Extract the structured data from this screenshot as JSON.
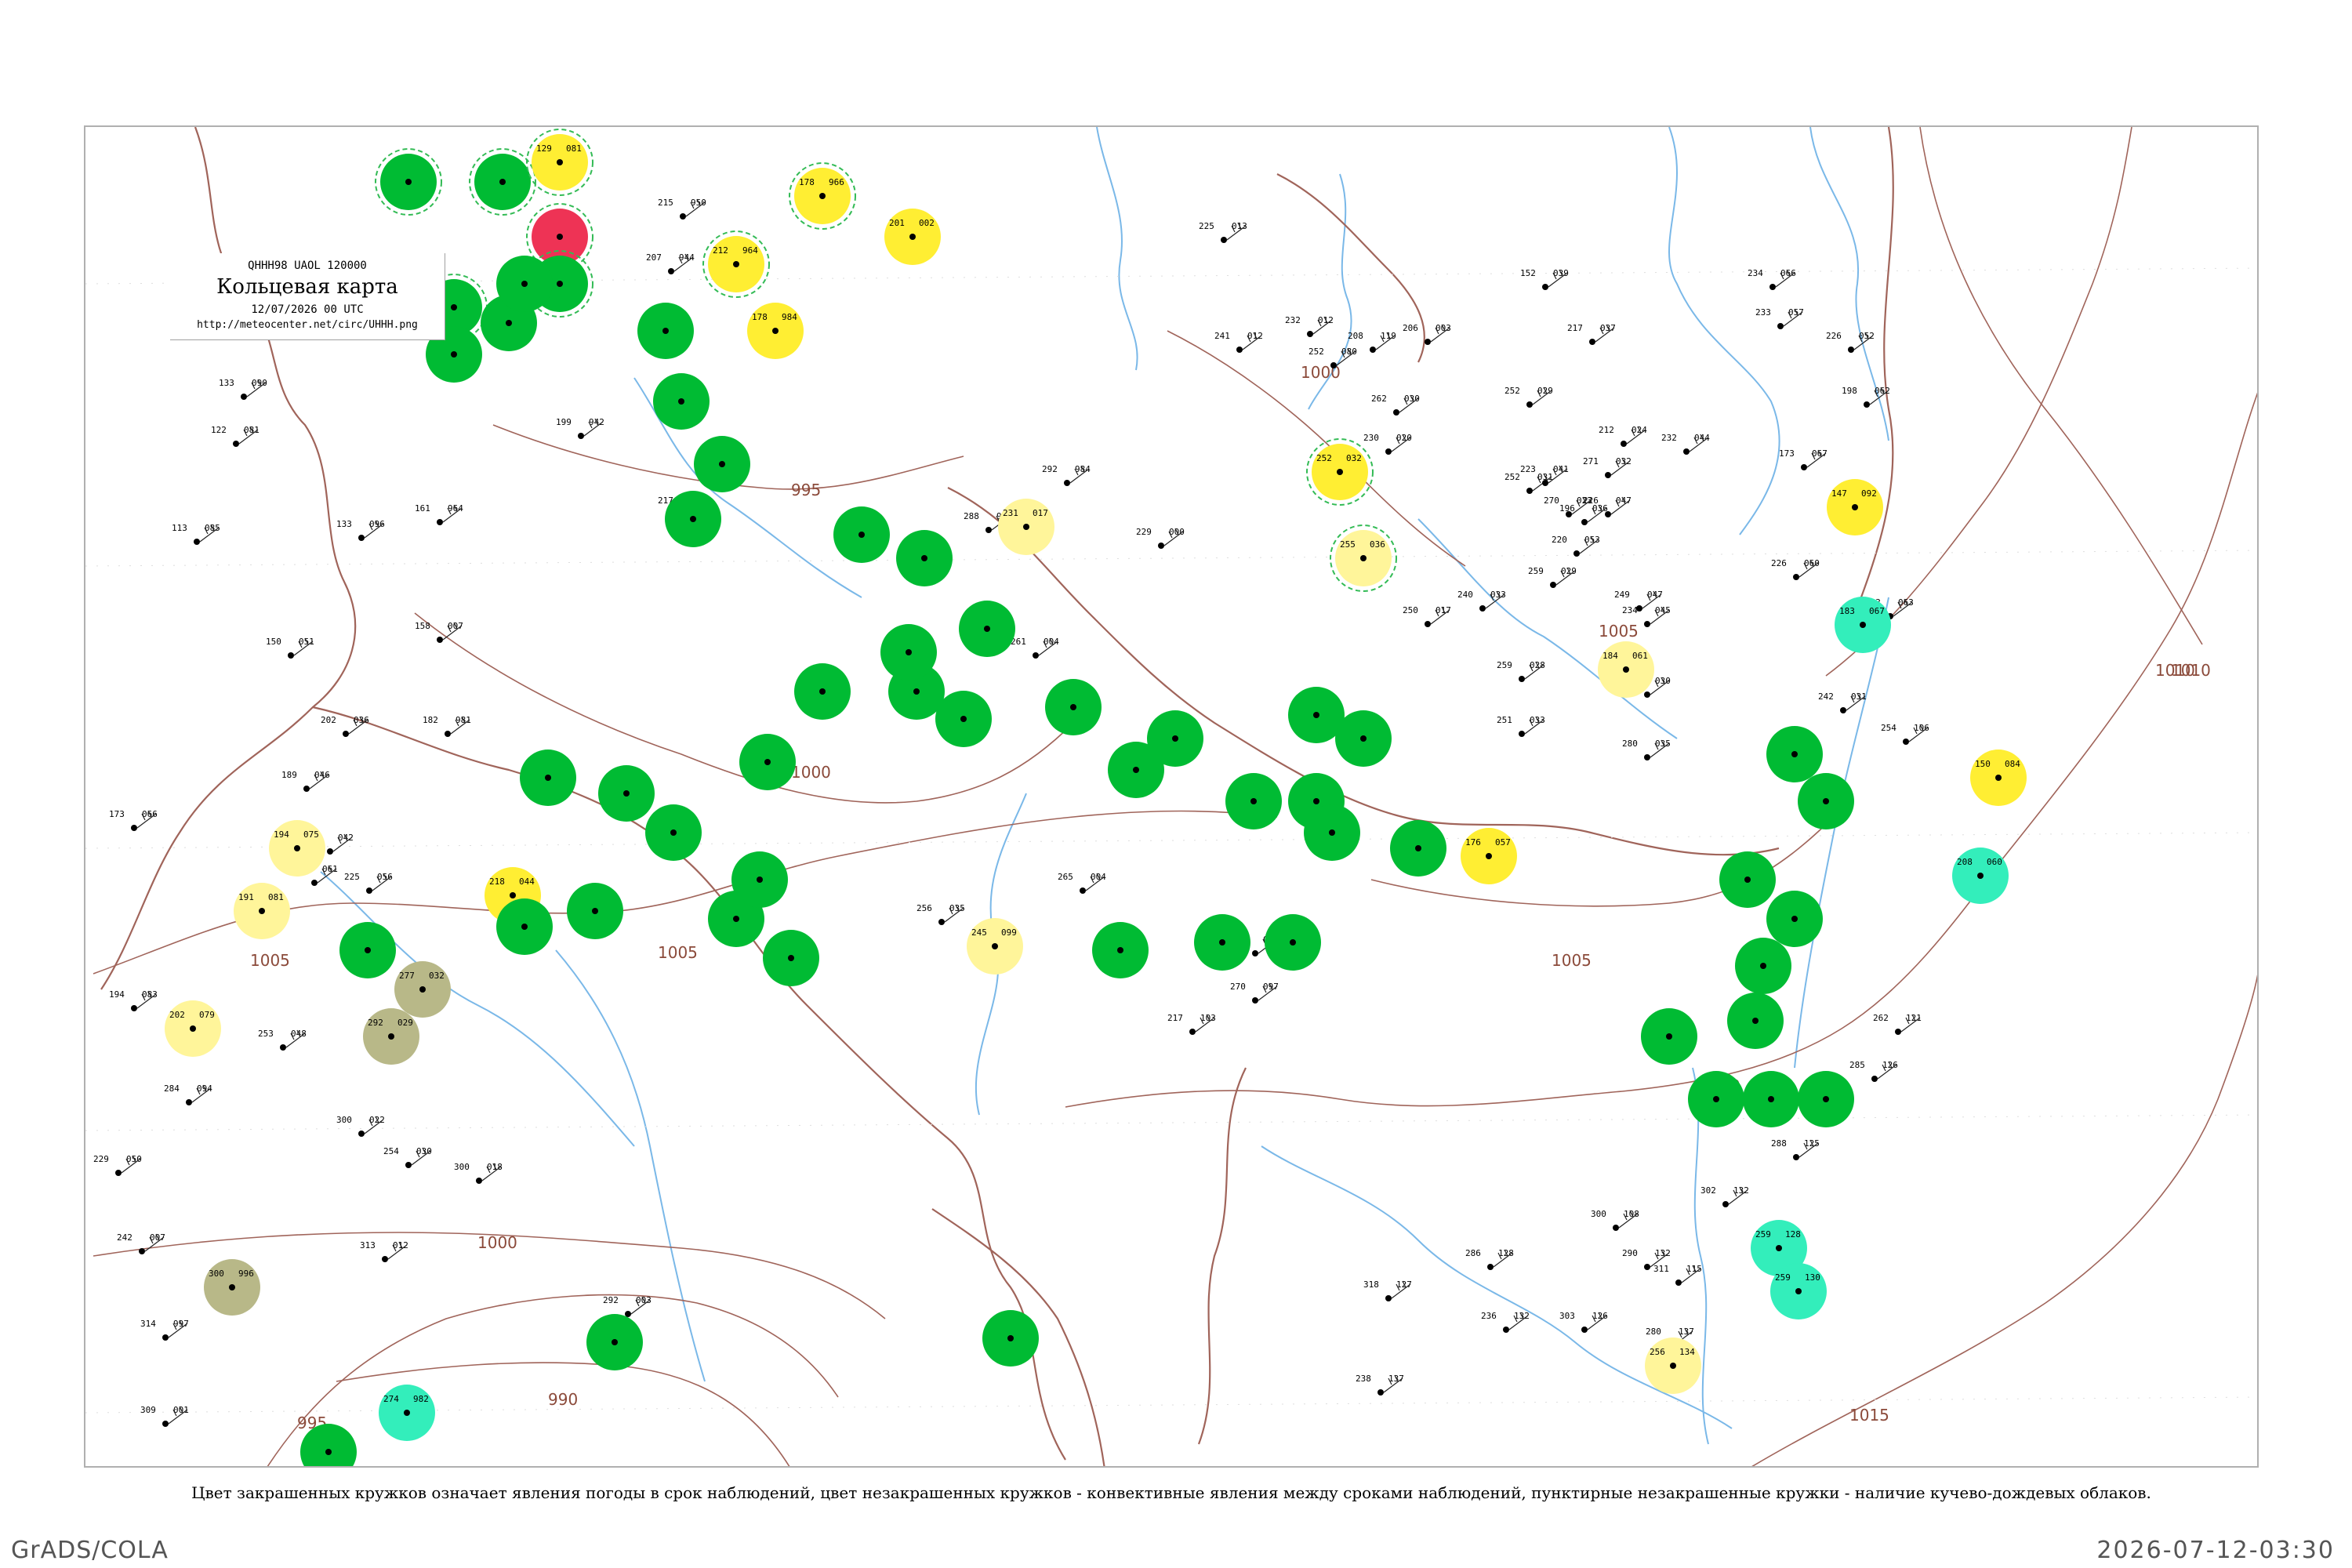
{
  "header": {
    "code_line": "QHHH98  UAOL  120000",
    "title": "Кольцевая карта",
    "date_line": "12/07/2026 00 UTC",
    "url": "http://meteocenter.net/circ/UHHH.png"
  },
  "caption": "Цвет закрашенных кружков означает явления погоды в срок наблюдений, цвет незакрашенных кружков - конвективные явления между сроками наблюдений, пунктирные незакрашенные кружки - наличие кучево-дождевых облаков.",
  "footer": {
    "left": "GrADS/COLA",
    "right": "2026-07-12-03:30"
  },
  "colors": {
    "green": "#00bb33",
    "yellow": "#ffee33",
    "pale_yellow": "#fff59a",
    "red": "#ee3355",
    "cyan": "#33eebb",
    "olive": "#b8b888",
    "isobar": "#a0645a",
    "river": "#7ab8e8",
    "dash_ring": "#33bb55"
  },
  "isobar_labels": [
    "1000",
    "995",
    "1000",
    "1005",
    "1005",
    "1005",
    "1010",
    "1005",
    "1005",
    "1010",
    "1000",
    "990",
    "995",
    "1015",
    "1010"
  ],
  "stations": [
    {
      "name": "s01",
      "fill": "green",
      "ring": true,
      "tl": "",
      "tr": "",
      "id": ""
    },
    {
      "name": "s02",
      "fill": "green",
      "ring": true,
      "tl": "",
      "tr": "",
      "id": ""
    },
    {
      "name": "s03",
      "fill": "yellow",
      "ring": true,
      "tl": "129",
      "tr": "081",
      "id": ""
    },
    {
      "name": "s04",
      "fill": "red",
      "ring": true,
      "tl": "",
      "tr": "",
      "id": ""
    },
    {
      "name": "s05",
      "fill": "green",
      "ring": true,
      "tl": "",
      "tr": "",
      "id": ""
    },
    {
      "name": "s06",
      "fill": "yellow",
      "ring": true,
      "tl": "178",
      "tr": "966",
      "id": ""
    },
    {
      "name": "s07",
      "fill": "yellow",
      "ring": false,
      "tl": "201",
      "tr": "002",
      "id": ""
    },
    {
      "name": "s08",
      "fill": "yellow",
      "ring": true,
      "tl": "212",
      "tr": "964",
      "id": ""
    },
    {
      "name": "s09",
      "fill": "yellow",
      "ring": false,
      "tl": "178",
      "tr": "984",
      "id": ""
    },
    {
      "name": "s10",
      "fill": "green",
      "ring": true,
      "tl": "",
      "tr": "",
      "id": ""
    },
    {
      "name": "s11",
      "fill": "green",
      "ring": false,
      "tl": "",
      "tr": "",
      "id": ""
    },
    {
      "name": "s12",
      "fill": "green",
      "ring": false,
      "tl": "",
      "tr": "",
      "id": ""
    },
    {
      "name": "s13",
      "fill": "green",
      "ring": false,
      "tl": "",
      "tr": "",
      "id": ""
    },
    {
      "name": "s14",
      "fill": "green",
      "ring": false,
      "tl": "",
      "tr": "",
      "id": ""
    },
    {
      "name": "s15",
      "fill": "green",
      "ring": false,
      "tl": "",
      "tr": "",
      "id": ""
    },
    {
      "name": "s16",
      "fill": "green",
      "ring": false,
      "tl": "",
      "tr": "",
      "id": ""
    },
    {
      "name": "s17",
      "fill": "green",
      "ring": false,
      "tl": "",
      "tr": "",
      "id": ""
    },
    {
      "name": "s18",
      "fill": "green",
      "ring": false,
      "tl": "",
      "tr": "",
      "id": ""
    },
    {
      "name": "s19",
      "fill": "green",
      "ring": false,
      "tl": "",
      "tr": "",
      "id": ""
    },
    {
      "name": "s20",
      "fill": "green",
      "ring": false,
      "tl": "",
      "tr": "",
      "id": ""
    },
    {
      "name": "s21",
      "fill": "green",
      "ring": false,
      "tl": "",
      "tr": "",
      "id": ""
    },
    {
      "name": "s22",
      "fill": "green",
      "ring": false,
      "tl": "",
      "tr": "",
      "id": ""
    },
    {
      "name": "s23",
      "fill": "yellow",
      "ring": false,
      "tl": "218",
      "tr": "044",
      "id": ""
    },
    {
      "name": "s24",
      "fill": "pale_yellow",
      "ring": false,
      "tl": "194",
      "tr": "075",
      "id": ""
    },
    {
      "name": "s25",
      "fill": "pale_yellow",
      "ring": false,
      "tl": "191",
      "tr": "081",
      "id": ""
    },
    {
      "name": "s26",
      "fill": "pale_yellow",
      "ring": false,
      "tl": "202",
      "tr": "079",
      "id": ""
    },
    {
      "name": "s27",
      "fill": "olive",
      "ring": false,
      "tl": "277",
      "tr": "032",
      "id": ""
    },
    {
      "name": "s28",
      "fill": "olive",
      "ring": false,
      "tl": "292",
      "tr": "029",
      "id": ""
    },
    {
      "name": "s29",
      "fill": "olive",
      "ring": false,
      "tl": "300",
      "tr": "996",
      "id": ""
    },
    {
      "name": "s30",
      "fill": "cyan",
      "ring": false,
      "tl": "274",
      "tr": "982",
      "id": ""
    },
    {
      "name": "s31",
      "fill": "green",
      "ring": false,
      "tl": "",
      "tr": "",
      "id": ""
    },
    {
      "name": "s32",
      "fill": "green",
      "ring": false,
      "tl": "",
      "tr": "",
      "id": ""
    },
    {
      "name": "s33",
      "fill": "pale_yellow",
      "ring": false,
      "tl": "231",
      "tr": "017",
      "id": ""
    },
    {
      "name": "s34",
      "fill": "pale_yellow",
      "ring": false,
      "tl": "245",
      "tr": "099",
      "id": ""
    },
    {
      "name": "s35",
      "fill": "yellow",
      "ring": true,
      "tl": "252",
      "tr": "032",
      "id": ""
    },
    {
      "name": "s36",
      "fill": "pale_yellow",
      "ring": true,
      "tl": "255",
      "tr": "036",
      "id": ""
    },
    {
      "name": "s37",
      "fill": "yellow",
      "ring": false,
      "tl": "176",
      "tr": "057",
      "id": ""
    },
    {
      "name": "s38",
      "fill": "pale_yellow",
      "ring": false,
      "tl": "184",
      "tr": "061",
      "id": ""
    },
    {
      "name": "s39",
      "fill": "yellow",
      "ring": false,
      "tl": "147",
      "tr": "092",
      "id": ""
    },
    {
      "name": "s40",
      "fill": "cyan",
      "ring": false,
      "tl": "183",
      "tr": "067",
      "id": ""
    },
    {
      "name": "s41",
      "fill": "yellow",
      "ring": false,
      "tl": "150",
      "tr": "084",
      "id": ""
    },
    {
      "name": "s42",
      "fill": "cyan",
      "ring": false,
      "tl": "208",
      "tr": "060",
      "id": ""
    },
    {
      "name": "s43",
      "fill": "cyan",
      "ring": false,
      "tl": "259",
      "tr": "128",
      "id": ""
    },
    {
      "name": "s44",
      "fill": "cyan",
      "ring": false,
      "tl": "259",
      "tr": "130",
      "id": ""
    },
    {
      "name": "s45",
      "fill": "pale_yellow",
      "ring": false,
      "tl": "256",
      "tr": "134",
      "id": ""
    },
    {
      "name": "s46",
      "fill": "green",
      "ring": false,
      "tl": "",
      "tr": "",
      "id": ""
    },
    {
      "name": "s47",
      "fill": "green",
      "ring": false,
      "tl": "",
      "tr": "",
      "id": ""
    },
    {
      "name": "s48",
      "fill": "green",
      "ring": false,
      "tl": "",
      "tr": "",
      "id": ""
    },
    {
      "name": "s49",
      "fill": "green",
      "ring": false,
      "tl": "",
      "tr": "",
      "id": ""
    },
    {
      "name": "s50",
      "fill": "green",
      "ring": false,
      "tl": "",
      "tr": "",
      "id": ""
    },
    {
      "name": "s51",
      "fill": "green",
      "ring": false,
      "tl": "",
      "tr": "",
      "id": ""
    },
    {
      "name": "s52",
      "fill": "green",
      "ring": false,
      "tl": "",
      "tr": "",
      "id": ""
    },
    {
      "name": "s53",
      "fill": "green",
      "ring": false,
      "tl": "",
      "tr": "",
      "id": ""
    },
    {
      "name": "s54",
      "fill": "green",
      "ring": false,
      "tl": "",
      "tr": "",
      "id": ""
    },
    {
      "name": "s55",
      "fill": "green",
      "ring": false,
      "tl": "",
      "tr": "",
      "id": ""
    },
    {
      "name": "s56",
      "fill": "green",
      "ring": false,
      "tl": "",
      "tr": "",
      "id": ""
    },
    {
      "name": "s57",
      "fill": "green",
      "ring": false,
      "tl": "",
      "tr": "",
      "id": ""
    },
    {
      "name": "s58",
      "fill": "green",
      "ring": false,
      "tl": "",
      "tr": "",
      "id": ""
    },
    {
      "name": "s59",
      "fill": "green",
      "ring": false,
      "tl": "",
      "tr": "",
      "id": ""
    },
    {
      "name": "s60",
      "fill": "green",
      "ring": false,
      "tl": "",
      "tr": "",
      "id": ""
    },
    {
      "name": "s61",
      "fill": "green",
      "ring": false,
      "tl": "",
      "tr": "",
      "id": ""
    },
    {
      "name": "s62",
      "fill": "green",
      "ring": false,
      "tl": "",
      "tr": "",
      "id": ""
    },
    {
      "name": "s63",
      "fill": "green",
      "ring": false,
      "tl": "",
      "tr": "",
      "id": ""
    },
    {
      "name": "s64",
      "fill": "green",
      "ring": false,
      "tl": "",
      "tr": "",
      "id": ""
    },
    {
      "name": "s65",
      "fill": "green",
      "ring": false,
      "tl": "",
      "tr": "",
      "id": ""
    },
    {
      "name": "s66",
      "fill": "green",
      "ring": false,
      "tl": "",
      "tr": "",
      "id": ""
    },
    {
      "name": "s67",
      "fill": "green",
      "ring": false,
      "tl": "",
      "tr": "",
      "id": ""
    },
    {
      "name": "s68",
      "fill": "green",
      "ring": false,
      "tl": "",
      "tr": "",
      "id": ""
    },
    {
      "name": "s69",
      "fill": "green",
      "ring": false,
      "tl": "",
      "tr": "",
      "id": ""
    },
    {
      "name": "s70",
      "fill": "green",
      "ring": false,
      "tl": "",
      "tr": "",
      "id": ""
    },
    {
      "name": "s71",
      "fill": "green",
      "ring": false,
      "tl": "",
      "tr": "",
      "id": ""
    },
    {
      "name": "s72",
      "fill": "green",
      "ring": false,
      "tl": "",
      "tr": "",
      "id": ""
    },
    {
      "name": "s73",
      "fill": "green",
      "ring": false,
      "tl": "",
      "tr": "",
      "id": ""
    },
    {
      "name": "s74",
      "fill": "green",
      "ring": false,
      "tl": "",
      "tr": "",
      "id": ""
    },
    {
      "name": "s75",
      "fill": "green",
      "ring": false,
      "tl": "",
      "tr": "",
      "id": ""
    },
    {
      "name": "s76",
      "fill": "green",
      "ring": false,
      "tl": "",
      "tr": "",
      "id": ""
    },
    {
      "name": "s77",
      "fill": "green",
      "ring": false,
      "tl": "",
      "tr": "",
      "id": ""
    },
    {
      "name": "s78",
      "fill": "green",
      "ring": false,
      "tl": "",
      "tr": "",
      "id": ""
    },
    {
      "name": "s79",
      "fill": "green",
      "ring": false,
      "tl": "",
      "tr": "",
      "id": ""
    },
    {
      "name": "s80",
      "fill": "green",
      "ring": false,
      "tl": "",
      "tr": "",
      "id": ""
    }
  ],
  "empty_stations": [
    {
      "tl": "215",
      "tr": "950"
    },
    {
      "tl": "207",
      "tr": "944"
    },
    {
      "tl": "199",
      "tr": "942"
    },
    {
      "tl": "217",
      "tr": "942"
    },
    {
      "tl": "161",
      "tr": "964"
    },
    {
      "tl": "133",
      "tr": "096"
    },
    {
      "tl": "122",
      "tr": "081"
    },
    {
      "tl": "133",
      "tr": "090"
    },
    {
      "tl": "113",
      "tr": "085"
    },
    {
      "tl": "150",
      "tr": "051"
    },
    {
      "tl": "158",
      "tr": "007"
    },
    {
      "tl": "182",
      "tr": "981"
    },
    {
      "tl": "202",
      "tr": "036"
    },
    {
      "tl": "189",
      "tr": "046"
    },
    {
      "tl": "173",
      "tr": "066"
    },
    {
      "tl": "201",
      "tr": "042"
    },
    {
      "tl": "193",
      "tr": "061"
    },
    {
      "tl": "225",
      "tr": "056"
    },
    {
      "tl": "194",
      "tr": "083"
    },
    {
      "tl": "253",
      "tr": "048"
    },
    {
      "tl": "284",
      "tr": "094"
    },
    {
      "tl": "300",
      "tr": "022"
    },
    {
      "tl": "229",
      "tr": "050"
    },
    {
      "tl": "242",
      "tr": "007"
    },
    {
      "tl": "254",
      "tr": "030"
    },
    {
      "tl": "300",
      "tr": "018"
    },
    {
      "tl": "313",
      "tr": "012"
    },
    {
      "tl": "292",
      "tr": "003"
    },
    {
      "tl": "314",
      "tr": "997"
    },
    {
      "tl": "309",
      "tr": "001"
    },
    {
      "tl": "288",
      "tr": "984"
    },
    {
      "tl": "292",
      "tr": "984"
    },
    {
      "tl": "229",
      "tr": "000"
    },
    {
      "tl": "261",
      "tr": "004"
    },
    {
      "tl": "265",
      "tr": "004"
    },
    {
      "tl": "256",
      "tr": "035"
    },
    {
      "tl": "285",
      "tr": "065"
    },
    {
      "tl": "270",
      "tr": "097"
    },
    {
      "tl": "217",
      "tr": "103"
    },
    {
      "tl": "208",
      "tr": "119"
    },
    {
      "tl": "252",
      "tr": "080"
    },
    {
      "tl": "262",
      "tr": "030"
    },
    {
      "tl": "241",
      "tr": "012"
    },
    {
      "tl": "225",
      "tr": "013"
    },
    {
      "tl": "206",
      "tr": "003"
    },
    {
      "tl": "232",
      "tr": "012"
    },
    {
      "tl": "230",
      "tr": "020"
    },
    {
      "tl": "250",
      "tr": "017"
    },
    {
      "tl": "240",
      "tr": "033"
    },
    {
      "tl": "259",
      "tr": "028"
    },
    {
      "tl": "260",
      "tr": "030"
    },
    {
      "tl": "251",
      "tr": "033"
    },
    {
      "tl": "280",
      "tr": "035"
    },
    {
      "tl": "234",
      "tr": "045"
    },
    {
      "tl": "226",
      "tr": "047"
    },
    {
      "tl": "220",
      "tr": "053"
    },
    {
      "tl": "249",
      "tr": "047"
    },
    {
      "tl": "252",
      "tr": "031"
    },
    {
      "tl": "271",
      "tr": "032"
    },
    {
      "tl": "252",
      "tr": "029"
    },
    {
      "tl": "242",
      "tr": "031"
    },
    {
      "tl": "259",
      "tr": "029"
    },
    {
      "tl": "270",
      "tr": "023"
    },
    {
      "tl": "196",
      "tr": "036"
    },
    {
      "tl": "212",
      "tr": "024"
    },
    {
      "tl": "223",
      "tr": "041"
    },
    {
      "tl": "152",
      "tr": "039"
    },
    {
      "tl": "217",
      "tr": "037"
    },
    {
      "tl": "232",
      "tr": "044"
    },
    {
      "tl": "234",
      "tr": "066"
    },
    {
      "tl": "233",
      "tr": "057"
    },
    {
      "tl": "226",
      "tr": "052"
    },
    {
      "tl": "198",
      "tr": "062"
    },
    {
      "tl": "173",
      "tr": "067"
    },
    {
      "tl": "226",
      "tr": "060"
    },
    {
      "tl": "233",
      "tr": "063"
    },
    {
      "tl": "254",
      "tr": "106"
    },
    {
      "tl": "262",
      "tr": "121"
    },
    {
      "tl": "285",
      "tr": "126"
    },
    {
      "tl": "288",
      "tr": "125"
    },
    {
      "tl": "302",
      "tr": "132"
    },
    {
      "tl": "300",
      "tr": "108"
    },
    {
      "tl": "290",
      "tr": "132"
    },
    {
      "tl": "311",
      "tr": "115"
    },
    {
      "tl": "318",
      "tr": "127"
    },
    {
      "tl": "286",
      "tr": "128"
    },
    {
      "tl": "303",
      "tr": "126"
    },
    {
      "tl": "280",
      "tr": "137"
    },
    {
      "tl": "236",
      "tr": "132"
    },
    {
      "tl": "238",
      "tr": "137"
    }
  ]
}
